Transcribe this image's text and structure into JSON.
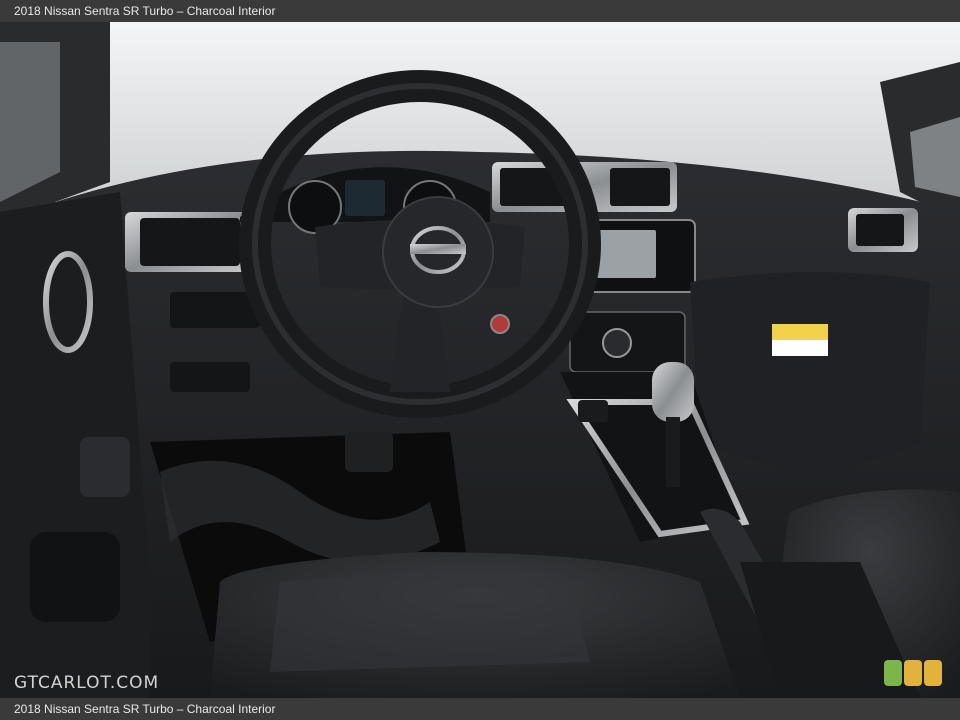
{
  "header": {
    "caption": "2018 Nissan Sentra SR Turbo – Charcoal Interior"
  },
  "footer": {
    "caption": "2018 Nissan Sentra SR Turbo – Charcoal Interior"
  },
  "watermark": {
    "text": "GTCARLOT.COM"
  },
  "photo": {
    "subject": "Car interior dashboard with steering wheel, center console and front seats",
    "badge_colors": [
      "#7ab648",
      "#e2b33a",
      "#e2b33a"
    ],
    "tag_text": ""
  },
  "colors": {
    "bar": "#3a3a3a",
    "interior": "#1e1f21",
    "windshield": "#e6e8ea"
  }
}
